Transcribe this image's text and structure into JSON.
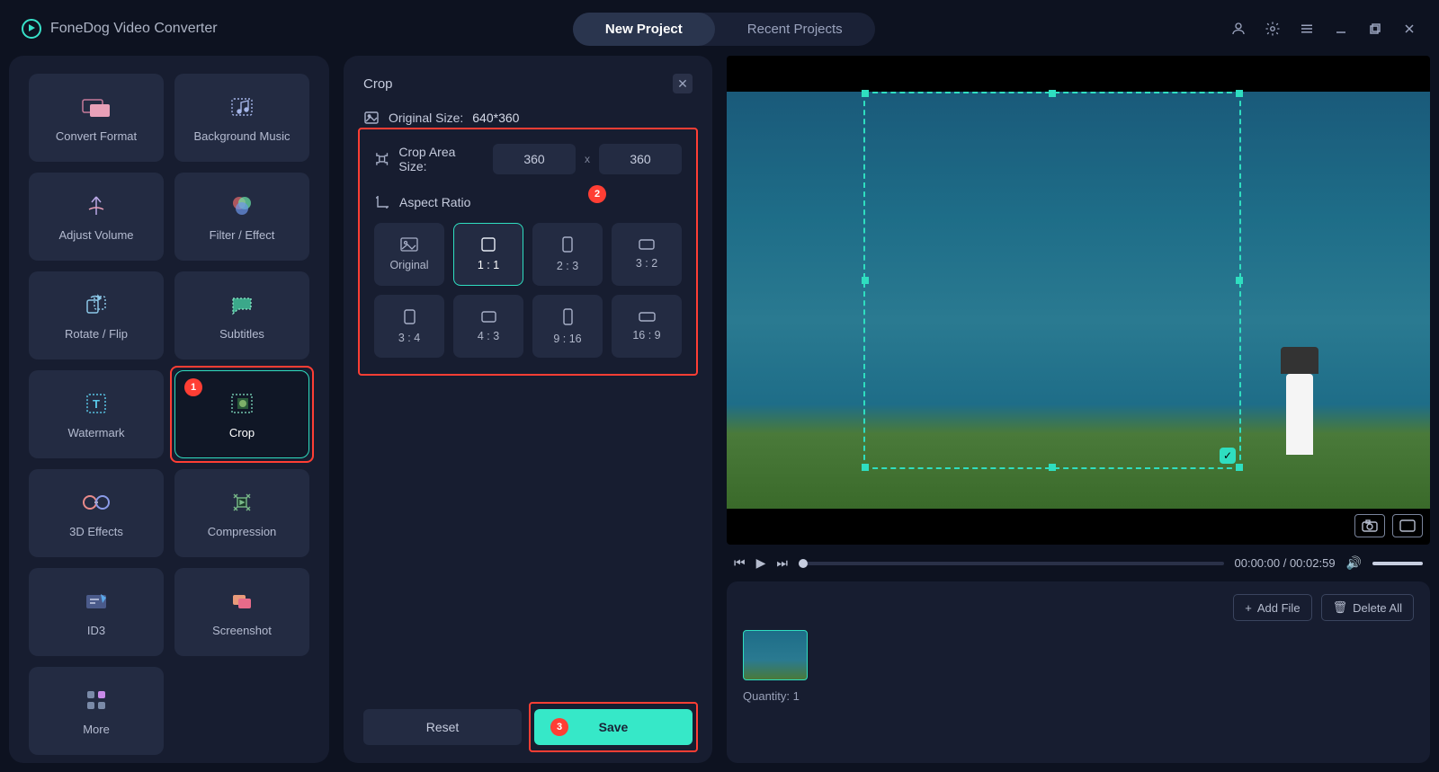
{
  "app": {
    "title": "FoneDog Video Converter"
  },
  "tabs": {
    "new_project": "New Project",
    "recent_projects": "Recent Projects"
  },
  "tools": {
    "convert_format": "Convert Format",
    "background_music": "Background Music",
    "adjust_volume": "Adjust Volume",
    "filter_effect": "Filter / Effect",
    "rotate_flip": "Rotate / Flip",
    "subtitles": "Subtitles",
    "watermark": "Watermark",
    "crop": "Crop",
    "3d_effects": "3D Effects",
    "compression": "Compression",
    "id3": "ID3",
    "screenshot": "Screenshot",
    "more": "More"
  },
  "crop_panel": {
    "title": "Crop",
    "original_size_label": "Original Size:",
    "original_size_value": "640*360",
    "crop_area_label": "Crop Area Size:",
    "width": "360",
    "height": "360",
    "aspect_ratio_label": "Aspect Ratio",
    "ratios": {
      "original": "Original",
      "r1_1": "1 : 1",
      "r2_3": "2 : 3",
      "r3_2": "3 : 2",
      "r3_4": "3 : 4",
      "r4_3": "4 : 3",
      "r9_16": "9 : 16",
      "r16_9": "16 : 9"
    },
    "reset": "Reset",
    "save": "Save"
  },
  "player": {
    "current_time": "00:00:00",
    "total_time": "00:02:59"
  },
  "file_area": {
    "add_file": "Add File",
    "delete_all": "Delete All",
    "quantity_label": "Quantity:",
    "quantity_value": "1"
  },
  "annotations": {
    "step1": "1",
    "step2": "2",
    "step3": "3"
  }
}
